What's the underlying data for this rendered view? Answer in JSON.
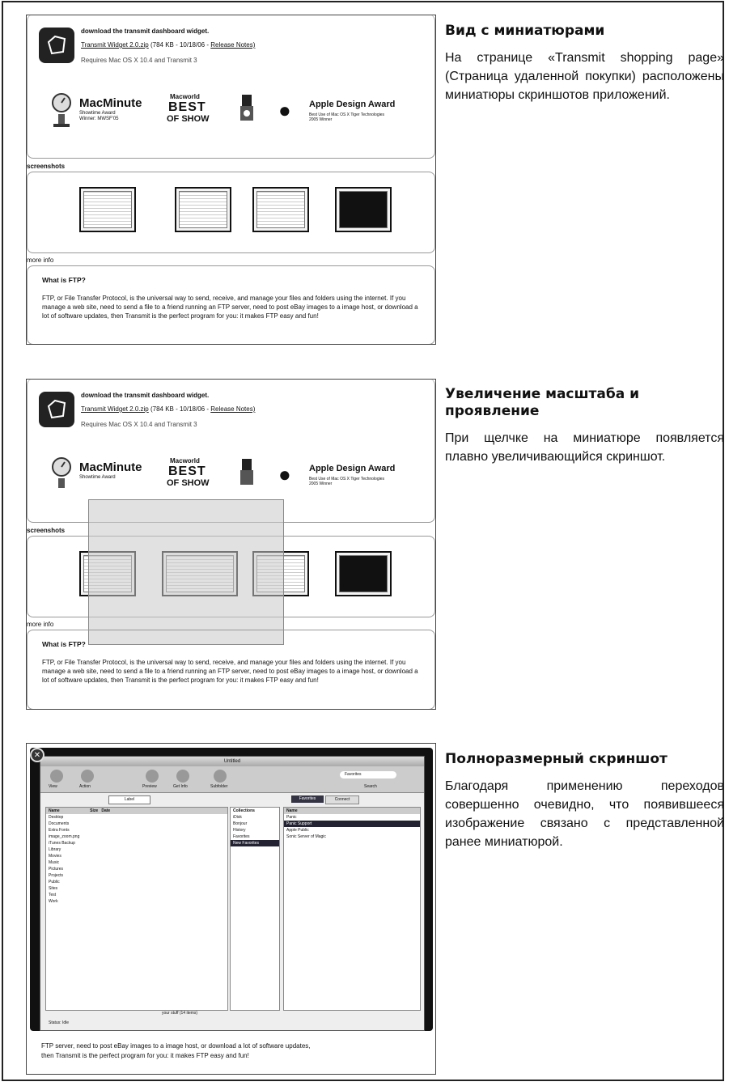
{
  "sections": [
    {
      "heading": "Вид с миниатюрами",
      "text": "На странице «Transmit shopping page» (Страница удаленной покупки) расположены миниатюры скриншотов приложений."
    },
    {
      "heading": "Увеличение масштаба и проявление",
      "text": "При щелчке на миниатюре появляется плавно увеличивающийся скриншот."
    },
    {
      "heading": "Полноразмерный скриншот",
      "text": "Благодаря применению переходов совершенно очевидно, что появившееся изображение связано с представленной ранее миниатюрой."
    }
  ],
  "widget": {
    "title": "download the transmit dashboard widget.",
    "link": "Transmit Widget 2.0.zip",
    "meta": "(784 KB - 10/18/06 -",
    "release_notes": "Release Notes)",
    "requires": "Requires Mac OS X 10.4 and Transmit 3"
  },
  "awards": {
    "macminute": "MacMinute",
    "macminute_sub1": "Showtime Award",
    "macminute_sub2": "Winner: MWSF'05",
    "macworld": "Macworld",
    "best": "BEST",
    "ofshow": "OF SHOW",
    "apple": "Apple Design Award",
    "apple_sub1": "Best Use of Mac OS X Tiger Technologies",
    "apple_sub2": "2005 Winner"
  },
  "labels": {
    "screenshots": "screenshots",
    "more_info": "more info",
    "what_is": "What is FTP?",
    "ftp_text": "FTP, or File Transfer Protocol, is the universal way to send, receive, and manage your files and folders using the internet. If you manage a web site, need to send a file to a friend running an FTP server, need to post eBay images to a image host, or download a lot of software updates, then Transmit is the perfect program for you: it makes FTP easy and fun!",
    "bottom_line1": "FTP server, need to post eBay images to a image host, or download a lot of software updates,",
    "bottom_line2": "then Transmit is the perfect program for you: it makes FTP easy and fun!"
  },
  "app": {
    "window_title": "Untitled",
    "tools": [
      "View",
      "Action",
      "Preview",
      "Get Info",
      "Subfolder",
      "Search"
    ],
    "search_placeholder": "Favorites",
    "local_label": "Label",
    "favorites_tab": "Favorites",
    "connect_tab": "Connect",
    "col_name": "Name",
    "col_size": "Size",
    "col_date": "Date",
    "files": [
      "Desktop",
      "Documents",
      "Extra Fonts",
      "image_zoom.png",
      "iTunes Backup",
      "Library",
      "Movies",
      "Music",
      "Pictures",
      "Projects",
      "Public",
      "Sites",
      "Test",
      "Work"
    ],
    "collections": [
      "Collections",
      "iDisk",
      "Bonjour",
      "History",
      "Favorites",
      "New Favorites"
    ],
    "favorites": [
      "Panic",
      "Panic Support",
      "Apple Public",
      "Sonic Server of Magic"
    ],
    "status": "Status: Idle",
    "footer": "your stuff (14 items)"
  }
}
